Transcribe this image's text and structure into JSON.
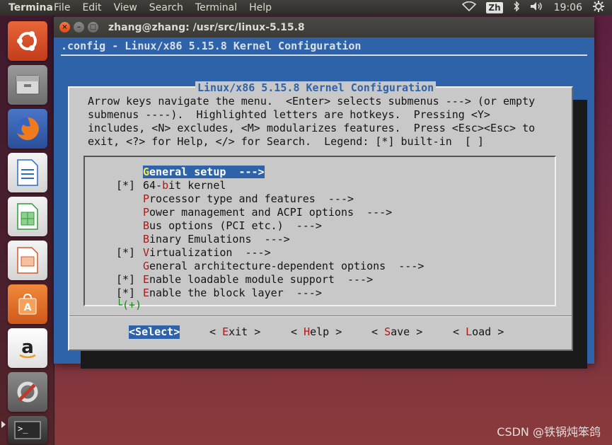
{
  "topbar": {
    "app_name": "Terminal",
    "menu": [
      "File",
      "Edit",
      "View",
      "Search",
      "Terminal",
      "Help"
    ],
    "input_method": "Zh",
    "clock": "19:06",
    "icons": [
      "wifi-icon",
      "bluetooth-icon",
      "volume-icon",
      "settings-icon"
    ]
  },
  "launcher": {
    "items": [
      {
        "name": "ubuntu-dash",
        "color": "#d64f2a"
      },
      {
        "name": "files",
        "color": "#7b7b7b"
      },
      {
        "name": "firefox",
        "color": "#e86a1f"
      },
      {
        "name": "libreoffice-writer",
        "color": "#2a7bd0"
      },
      {
        "name": "libreoffice-calc",
        "color": "#2e9c3a"
      },
      {
        "name": "libreoffice-impress",
        "color": "#d05a2a"
      },
      {
        "name": "ubuntu-software",
        "color": "#e0742a"
      },
      {
        "name": "amazon",
        "color": "#f0f0f0"
      },
      {
        "name": "system-settings",
        "color": "#b03a2a"
      },
      {
        "name": "terminal",
        "color": "#3a3a3a"
      }
    ]
  },
  "window": {
    "title": "zhang@zhang: /usr/src/linux-5.15.8"
  },
  "menuconfig": {
    "header": ".config - Linux/x86 5.15.8 Kernel Configuration",
    "dialog_title": "Linux/x86 5.15.8 Kernel Configuration",
    "help_text": "Arrow keys navigate the menu.  <Enter> selects submenus ---> (or empty\nsubmenus ----).  Highlighted letters are hotkeys.  Pressing <Y>\nincludes, <N> excludes, <M> modularizes features.  Press <Esc><Esc> to\nexit, <?> for Help, </> for Search.  Legend: [*] built-in  [ ]",
    "items": [
      {
        "prefix": "",
        "hotkey": "G",
        "rest": "eneral setup  --->",
        "selected": true
      },
      {
        "prefix": "[*]",
        "pre": "64-",
        "hotkey": "b",
        "rest": "it kernel",
        "selected": false
      },
      {
        "prefix": "",
        "hotkey": "P",
        "rest": "rocessor type and features  --->",
        "selected": false
      },
      {
        "prefix": "",
        "hotkey": "P",
        "rest": "ower management and ACPI options  --->",
        "selected": false
      },
      {
        "prefix": "",
        "hotkey": "B",
        "rest": "us options (PCI etc.)  --->",
        "selected": false
      },
      {
        "prefix": "",
        "hotkey": "B",
        "rest": "inary Emulations  --->",
        "selected": false
      },
      {
        "prefix": "[*]",
        "hotkey": "V",
        "rest": "irtualization  --->",
        "selected": false
      },
      {
        "prefix": "",
        "hotkey": "G",
        "rest": "eneral architecture-dependent options  --->",
        "selected": false
      },
      {
        "prefix": "[*]",
        "hotkey": "E",
        "rest": "nable loadable module support  --->",
        "selected": false
      },
      {
        "prefix": "[*]",
        "hotkey": "E",
        "rest": "nable the block layer  --->",
        "selected": false
      }
    ],
    "more_indicator": "└(+)",
    "buttons": [
      {
        "open": "<",
        "hotkey": "S",
        "rest": "elect",
        "close": ">",
        "active": true
      },
      {
        "open": "< ",
        "hotkey": "E",
        "rest": "xit",
        "close": " >",
        "active": false
      },
      {
        "open": "< ",
        "hotkey": "H",
        "rest": "elp",
        "close": " >",
        "active": false
      },
      {
        "open": "< ",
        "hotkey": "S",
        "rest": "ave",
        "close": " >",
        "active": false
      },
      {
        "open": "< ",
        "hotkey": "L",
        "rest": "oad",
        "close": " >",
        "active": false
      }
    ]
  },
  "watermark": "CSDN @铁锅炖笨鸽"
}
